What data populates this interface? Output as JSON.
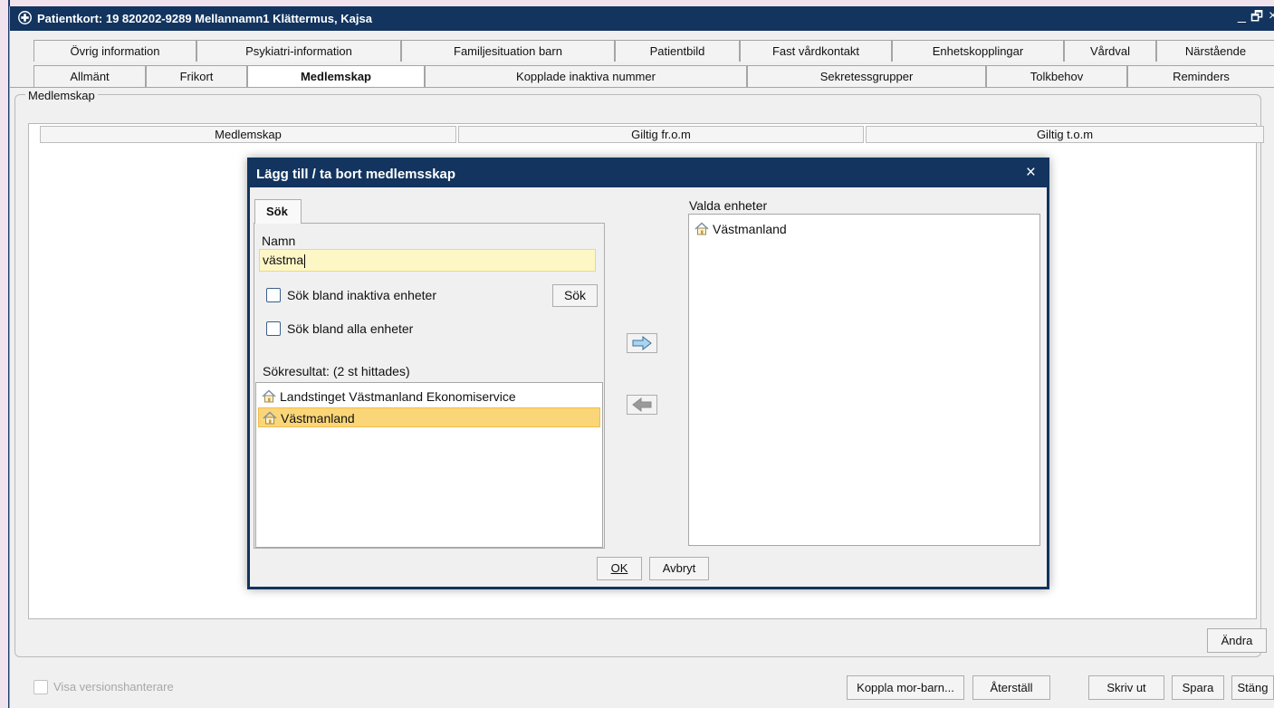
{
  "window": {
    "title": "Patientkort: 19 820202-9289 Mellannamn1 Klättermus, Kajsa",
    "minimize_glyph": "_",
    "restore_glyph": "🗗",
    "close_glyph": "×"
  },
  "tabs_row1": [
    {
      "label": "Övrig information"
    },
    {
      "label": "Psykiatri-information"
    },
    {
      "label": "Familjesituation barn"
    },
    {
      "label": "Patientbild"
    },
    {
      "label": "Fast vårdkontakt"
    },
    {
      "label": "Enhetskopplingar"
    },
    {
      "label": "Vårdval"
    },
    {
      "label": "Närstående"
    }
  ],
  "tabs_row2": [
    {
      "label": "Allmänt"
    },
    {
      "label": "Frikort"
    },
    {
      "label": "Medlemskap",
      "active": true
    },
    {
      "label": "Kopplade inaktiva nummer"
    },
    {
      "label": "Sekretessgrupper"
    },
    {
      "label": "Tolkbehov"
    },
    {
      "label": "Reminders"
    }
  ],
  "group": {
    "legend": "Medlemskap",
    "columns": [
      "Medlemskap",
      "Giltig fr.o.m",
      "Giltig t.o.m"
    ],
    "andra_label": "Ändra"
  },
  "footer": {
    "versions_label": "Visa versionshanterare",
    "buttons": {
      "koppla": "Koppla mor-barn...",
      "aterstall": "Återställ",
      "skriv_ut": "Skriv ut",
      "spara": "Spara",
      "stang": "Stäng"
    }
  },
  "dialog": {
    "title": "Lägg till / ta bort medlemsskap",
    "close_glyph": "×",
    "tab_label": "Sök",
    "name_label": "Namn",
    "name_value": "västma",
    "check_inactive_label": "Sök bland inaktiva enheter",
    "check_all_label": "Sök bland alla enheter",
    "search_button": "Sök",
    "results_label": "Sökresultat: (2 st hittades)",
    "results": [
      {
        "label": "Landstinget Västmanland Ekonomiservice",
        "selected": false
      },
      {
        "label": "Västmanland",
        "selected": true
      }
    ],
    "selected_label": "Valda enheter",
    "selected_items": [
      {
        "label": "Västmanland"
      }
    ],
    "ok_label": "OK",
    "cancel_label": "Avbryt"
  },
  "colors": {
    "titlebar": "#12345e",
    "selection": "#fbd679",
    "input_bg": "#fdf7c6"
  }
}
